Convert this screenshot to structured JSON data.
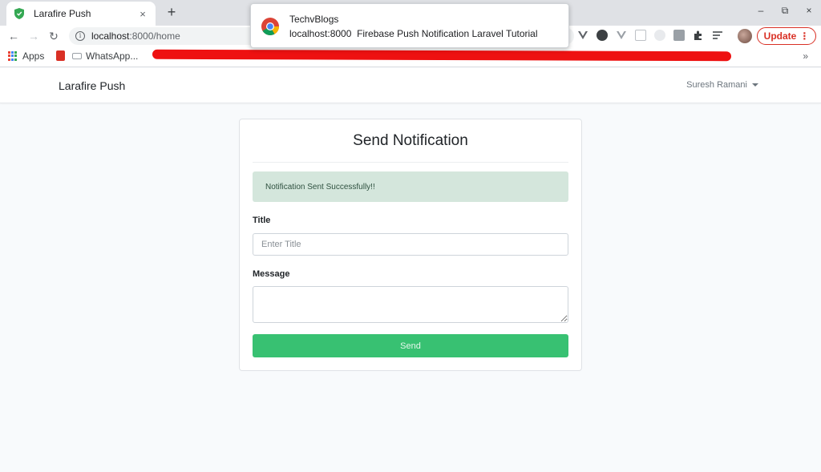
{
  "browser": {
    "tab": {
      "title": "Larafire Push",
      "close": "×",
      "favicon": "shield-icon"
    },
    "new_tab": "+",
    "window_controls": [
      "–",
      "⧉",
      "×"
    ],
    "nav": {
      "back": "←",
      "forward": "→",
      "reload": "↻"
    },
    "address": {
      "host": "localhost",
      "path": ":8000/home",
      "info": "i"
    },
    "update_button": "Update",
    "update_menu": "⋮",
    "bookmarks": [
      {
        "label": "Apps",
        "icon": "apps-grid-icon"
      },
      {
        "label": "",
        "icon": "red-bookmark-icon"
      },
      {
        "label": "WhatsApp...",
        "icon": "whatsapp-icon"
      }
    ],
    "bookmarks_overflow": "»"
  },
  "notification": {
    "sender": "TechvBlogs",
    "origin": "localhost:8000",
    "message": "Firebase Push Notification Laravel Tutorial",
    "icon": "chrome-icon"
  },
  "navbar": {
    "brand": "Larafire Push",
    "user": "Suresh Ramani"
  },
  "card": {
    "title": "Send Notification",
    "alert": "Notification Sent Successfully!!",
    "title_label": "Title",
    "title_placeholder": "Enter Title",
    "message_label": "Message",
    "send_label": "Send"
  },
  "colors": {
    "accent_green": "#38c172",
    "alert_bg": "#d4e6dc",
    "update_red": "#d93025",
    "redaction_red": "#ee1111"
  }
}
